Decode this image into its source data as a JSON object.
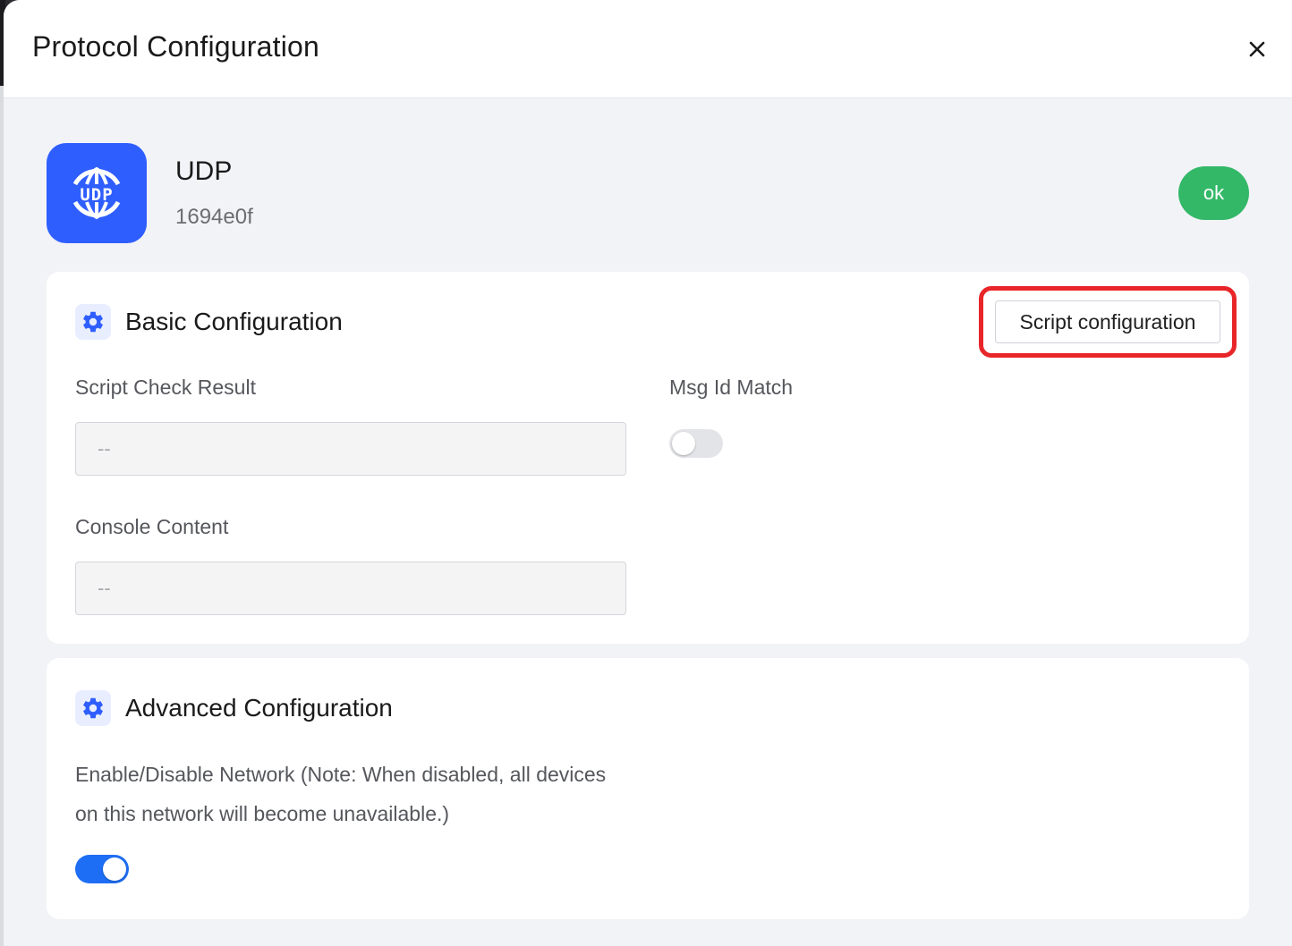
{
  "dialog": {
    "title": "Protocol Configuration",
    "close_icon": "close-icon"
  },
  "protocol": {
    "icon": "udp-globe-icon",
    "icon_text": "UDP",
    "name": "UDP",
    "id": "1694e0f",
    "ok_label": "ok"
  },
  "basic": {
    "title": "Basic Configuration",
    "icon": "gear-icon",
    "script_button_label": "Script configuration",
    "script_check_label": "Script Check Result",
    "script_check_value": "--",
    "console_label": "Console Content",
    "console_value": "--",
    "msg_id_label": "Msg Id Match",
    "msg_id_enabled": false
  },
  "advanced": {
    "title": "Advanced Configuration",
    "icon": "gear-icon",
    "network_label": "Enable/Disable Network (Note: When disabled, all devices on this network will become unavailable.)",
    "network_enabled": true
  },
  "colors": {
    "accent": "#2f5eff",
    "ok_green": "#33b868",
    "toggle_on": "#1e6ef5",
    "highlight": "#e8262a"
  }
}
